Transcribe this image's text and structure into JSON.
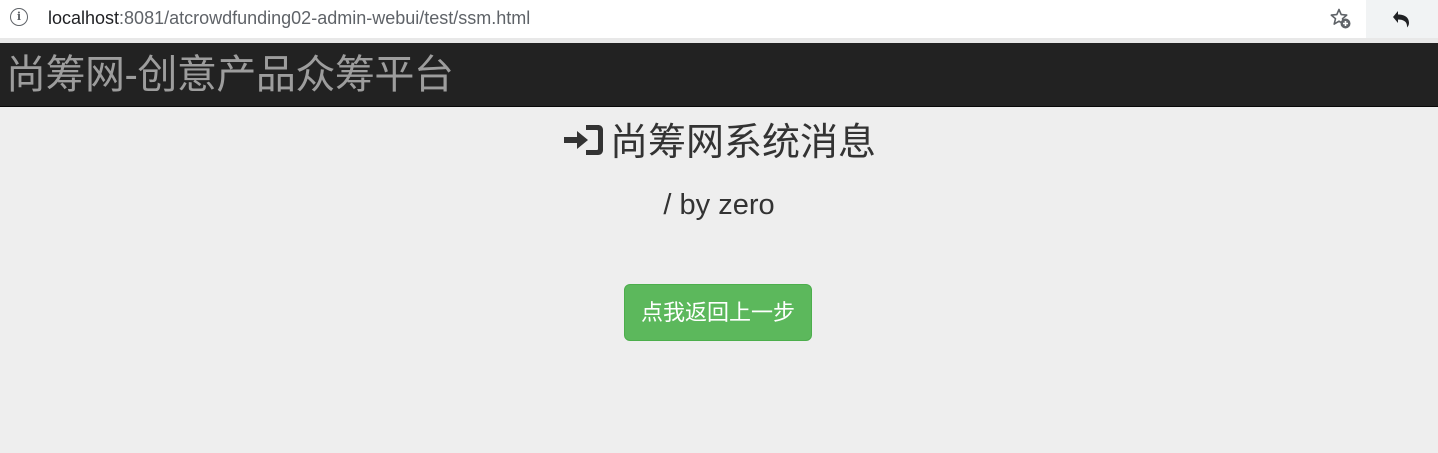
{
  "browser": {
    "url_host": "localhost",
    "url_rest": ":8081/atcrowdfunding02-admin-webui/test/ssm.html",
    "info_icon": "info-icon",
    "bookmark_icon": "star-add-icon",
    "extension_icon": "undo-icon"
  },
  "navbar": {
    "brand": "尚筹网-创意产品众筹平台"
  },
  "main": {
    "heading_icon": "login-icon",
    "heading": "尚筹网系统消息",
    "message": "/ by zero",
    "back_button": "点我返回上一步"
  },
  "colors": {
    "navbar_bg": "#222222",
    "brand_text": "#9d9d9d",
    "page_bg": "#eeeeee",
    "button_bg": "#5cb85c"
  }
}
